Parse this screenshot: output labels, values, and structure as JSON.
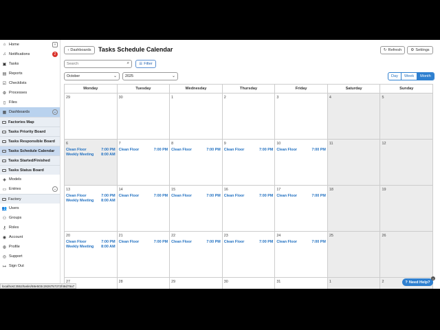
{
  "sidebar": {
    "items": [
      {
        "label": "Home",
        "icon": "home-icon",
        "glyph": "⌂"
      },
      {
        "label": "Notifications",
        "icon": "bell-icon",
        "glyph": "♫",
        "badge": "2"
      },
      {
        "label": "Tasks",
        "icon": "tasks-icon",
        "glyph": "▣"
      },
      {
        "label": "Reports",
        "icon": "report-icon",
        "glyph": "▤"
      },
      {
        "label": "Checklists",
        "icon": "checklist-icon",
        "glyph": "☑"
      },
      {
        "label": "Processes",
        "icon": "process-icon",
        "glyph": "⚙"
      },
      {
        "label": "Files",
        "icon": "file-icon",
        "glyph": "▯"
      },
      {
        "label": "Dashboards",
        "icon": "dashboard-icon",
        "glyph": "▦"
      },
      {
        "label": "Factories Map",
        "icon": "board-icon"
      },
      {
        "label": "Tasks Priority Board",
        "icon": "board-icon"
      },
      {
        "label": "Tasks Responsible Board",
        "icon": "board-icon"
      },
      {
        "label": "Tasks Schedule Calendar",
        "icon": "board-icon"
      },
      {
        "label": "Tasks Started/Finished",
        "icon": "board-icon"
      },
      {
        "label": "Tasks Status Board",
        "icon": "board-icon"
      },
      {
        "label": "Models",
        "icon": "model-icon",
        "glyph": "◈"
      },
      {
        "label": "Entries",
        "icon": "entries-icon",
        "glyph": "▭"
      },
      {
        "label": "Factory",
        "icon": "factory-icon",
        "glyph": "▭"
      },
      {
        "label": "Users",
        "icon": "users-icon",
        "glyph": "👥"
      },
      {
        "label": "Groups",
        "icon": "groups-icon",
        "glyph": "⚇"
      },
      {
        "label": "Roles",
        "icon": "roles-icon",
        "glyph": "⚷"
      },
      {
        "label": "Account",
        "icon": "account-icon",
        "glyph": "◉"
      },
      {
        "label": "Profile",
        "icon": "profile-icon",
        "glyph": "◍"
      },
      {
        "label": "Support",
        "icon": "support-icon",
        "glyph": "◎"
      },
      {
        "label": "Sign Out",
        "icon": "signout-icon",
        "glyph": "↦"
      }
    ],
    "collapse_glyph": "«",
    "chevron_glyph": "⌄"
  },
  "header": {
    "back_label": "Dashboards",
    "title": "Tasks Schedule Calendar",
    "refresh_label": "Refresh",
    "settings_label": "Settings"
  },
  "toolbar": {
    "search_placeholder": "Search",
    "filter_label": "Filter",
    "month": "October",
    "year": "2025",
    "views": [
      "Day",
      "Week",
      "Month"
    ],
    "active_view": "Month"
  },
  "calendar": {
    "weekdays": [
      "Monday",
      "Tuesday",
      "Wednesday",
      "Thursday",
      "Friday",
      "Saturday",
      "Sunday"
    ],
    "weeks": [
      [
        {
          "d": "29"
        },
        {
          "d": "30"
        },
        {
          "d": "1"
        },
        {
          "d": "2"
        },
        {
          "d": "3"
        },
        {
          "d": "4",
          "w": true
        },
        {
          "d": "5",
          "w": true
        }
      ],
      [
        {
          "d": "6",
          "today": true,
          "ev": [
            [
              "Clean Floor",
              "7:00 PM"
            ],
            [
              "Weekly Meeting",
              "8:00 AM"
            ]
          ]
        },
        {
          "d": "7",
          "ev": [
            [
              "Clean Floor",
              "7:00 PM"
            ]
          ]
        },
        {
          "d": "8",
          "ev": [
            [
              "Clean Floor",
              "7:00 PM"
            ]
          ]
        },
        {
          "d": "9",
          "ev": [
            [
              "Clean Floor",
              "7:00 PM"
            ]
          ]
        },
        {
          "d": "10",
          "ev": [
            [
              "Clean Floor",
              "7:00 PM"
            ]
          ]
        },
        {
          "d": "11",
          "w": true
        },
        {
          "d": "12",
          "w": true
        }
      ],
      [
        {
          "d": "13",
          "ev": [
            [
              "Clean Floor",
              "7:00 PM"
            ],
            [
              "Weekly Meeting",
              "8:00 AM"
            ]
          ]
        },
        {
          "d": "14",
          "ev": [
            [
              "Clean Floor",
              "7:00 PM"
            ]
          ]
        },
        {
          "d": "15",
          "ev": [
            [
              "Clean Floor",
              "7:00 PM"
            ]
          ]
        },
        {
          "d": "16",
          "ev": [
            [
              "Clean Floor",
              "7:00 PM"
            ]
          ]
        },
        {
          "d": "17",
          "ev": [
            [
              "Clean Floor",
              "7:00 PM"
            ]
          ]
        },
        {
          "d": "18",
          "w": true
        },
        {
          "d": "19",
          "w": true
        }
      ],
      [
        {
          "d": "20",
          "ev": [
            [
              "Clean Floor",
              "7:00 PM"
            ],
            [
              "Weekly Meeting",
              "8:00 AM"
            ]
          ]
        },
        {
          "d": "21",
          "ev": [
            [
              "Clean Floor",
              "7:00 PM"
            ]
          ]
        },
        {
          "d": "22",
          "ev": [
            [
              "Clean Floor",
              "7:00 PM"
            ]
          ]
        },
        {
          "d": "23",
          "ev": [
            [
              "Clean Floor",
              "7:00 PM"
            ]
          ]
        },
        {
          "d": "24",
          "ev": [
            [
              "Clean Floor",
              "7:00 PM"
            ]
          ]
        },
        {
          "d": "25",
          "w": true
        },
        {
          "d": "26",
          "w": true
        }
      ],
      [
        {
          "d": "27"
        },
        {
          "d": "28"
        },
        {
          "d": "29"
        },
        {
          "d": "30"
        },
        {
          "d": "31"
        },
        {
          "d": "1",
          "w": true
        },
        {
          "d": "2",
          "w": true
        }
      ]
    ]
  },
  "status_url": "localhost:3552/tasks/68e503c2826757372f48d79a7",
  "help": {
    "label": "Need Help?",
    "close": "×"
  },
  "colors": {
    "accent": "#2f80d0",
    "event": "#1f6fc0",
    "badge": "#d9322b"
  }
}
